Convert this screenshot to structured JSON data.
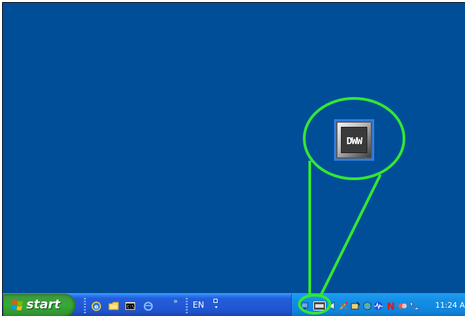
{
  "taskbar": {
    "start_label": "start",
    "language": "EN",
    "chevron": "»",
    "quick_launch": [
      "ie-icon",
      "folder-icon",
      "command-prompt-icon",
      "ie-blue-icon"
    ]
  },
  "tray": {
    "clock": "11:24 AM",
    "icons": [
      "network-icon",
      "dww-icon",
      "speaker-icon",
      "tools-icon",
      "scanner-icon",
      "globe-icon",
      "wave-icon",
      "n-icon",
      "update-icon",
      "phone-icon"
    ]
  },
  "desktop": {
    "zoom_icon_text": "DWW"
  },
  "colors": {
    "desktop_bg": "#004e98",
    "highlight_green": "#33e633",
    "start_green": "#37a937",
    "taskbar_blue": "#245edb",
    "tray_blue": "#0f83da"
  }
}
